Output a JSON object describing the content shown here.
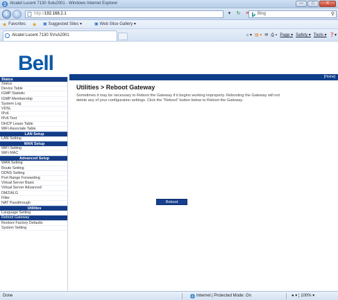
{
  "window": {
    "title": "Alcatel Lucent 7130 Sulu2001 - Windows Internet Explorer",
    "min_label": "—",
    "max_label": "□",
    "close_label": "X"
  },
  "address_bar": {
    "scheme": "http://",
    "host": "192.168.2.1",
    "search_placeholder": "Bing"
  },
  "favorites_bar": {
    "favorites_label": "Favorites",
    "suggested_label": "Suggested Sites ▾",
    "webslice_label": "Web Slice Gallery ▾"
  },
  "tab": {
    "title": "Alcatel Lucent 7130 SVsA2001"
  },
  "command_bar": {
    "page_label": "Page ▾",
    "safety_label": "Safety ▾",
    "tools_label": "Tools ▾"
  },
  "page": {
    "logo": "Bell",
    "home_link": "[Home]",
    "title": "Utilities > Reboot Gateway",
    "description": "Sometimes it may be necessary to Reboot the Gateway if it begins working improperly. Rebooting the Gateway will not delete any of your configuration settings. Click the \"Reboot\" button below to Reboot the Gateway.",
    "reboot_button": "Reboot"
  },
  "sidebar": {
    "sections": [
      {
        "heading": "Status",
        "items": [
          "Status",
          "Device Table",
          "IGMP Statistic",
          "IGMP Membership",
          "System Log",
          "VDSL",
          "IPv6",
          "IPv6 Test",
          "DHCP Lease Table",
          "WiFi Associate Table"
        ]
      },
      {
        "heading": "LAN Setup",
        "items": [
          "LAN Setting"
        ]
      },
      {
        "heading": "WAN Setup",
        "items": [
          "WiFi Setting",
          "WiFi MAC"
        ]
      },
      {
        "heading": "Advanced Setup",
        "items": [
          "WAN Setting",
          "Route Setting",
          "DDNS Setting",
          "Port Range Forwarding",
          "Virtual Server Basic",
          "Virtual Server Advanced",
          "DMZ/ALG",
          "Filter",
          "NAT Passthrough"
        ]
      },
      {
        "heading": "Utilities",
        "items": [
          "Language Setting",
          "Reboot Gateway",
          "Restore Factory Defaults",
          "System Setting"
        ]
      }
    ],
    "active_item": "Reboot Gateway"
  },
  "status_bar": {
    "left_text": "Done",
    "zone_text": "Internet | Protected Mode: On",
    "zoom_text": "● ▾  ¦ 100% ▾"
  },
  "colors": {
    "brand_blue": "#0b5aa8",
    "nav_dark": "#153c86"
  }
}
